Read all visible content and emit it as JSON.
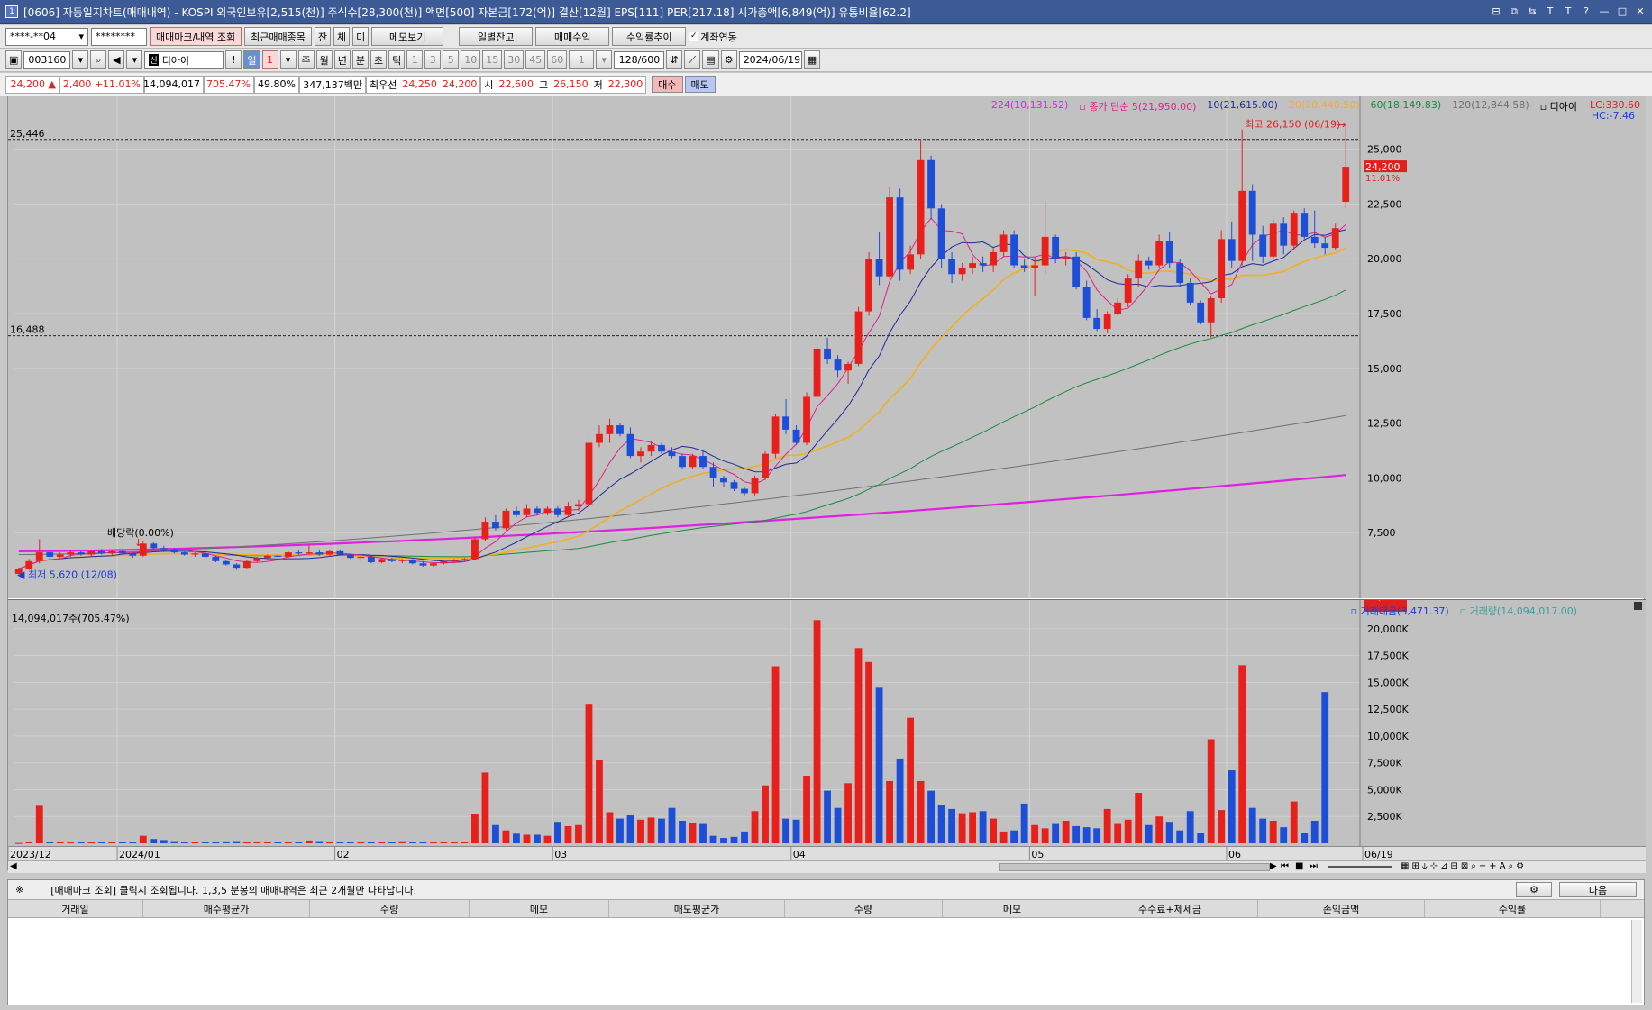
{
  "window": {
    "title": "[0606] 자동일지차트(매매내역) - KOSPI 외국인보유[2,515(천)] 주식수[28,300(천)] 액면[500] 자본금[172(억)] 결산[12월] EPS[111] PER[217.18] 시가총액[6,849(억)] 유통비율[62.2]",
    "window_number": "1"
  },
  "toolbar1": {
    "account": "****-**04",
    "password": "********",
    "btn_query": "매매마크/내역 조회",
    "btn_recent": "최근매매종목",
    "btn_jan": "잔",
    "btn_che": "체",
    "btn_mi": "미",
    "btn_memo": "메모보기",
    "btn_daily_balance": "일별잔고",
    "btn_trade_profit": "매매수익",
    "btn_yield_trend": "수익률추이",
    "chk_link_label": "계좌연동",
    "chk_link_checked": true
  },
  "toolbar2": {
    "code": "003160",
    "stock_name": "디아이",
    "market_badge": "신",
    "btn_excl": "!",
    "period_day": "일",
    "period_n": "1",
    "periods": [
      "주",
      "월",
      "년",
      "분",
      "초",
      "틱"
    ],
    "minutes": [
      "1",
      "3",
      "5",
      "10",
      "15",
      "30",
      "45",
      "60"
    ],
    "mult": "1",
    "count": "128/600",
    "date": "2024/06/19"
  },
  "quote": {
    "price": "24,200",
    "arrow": "▲",
    "change": "2,400",
    "change_pct": "+11.01%",
    "volume": "14,094,017",
    "vol_ratio": "705.47%",
    "turnover": "49.80%",
    "amount": "347,137백만",
    "best_label": "최우선",
    "best_ask": "24,250",
    "best_bid": "24,200",
    "open_label": "시",
    "open": "22,600",
    "high_label": "고",
    "high": "26,150",
    "low_label": "저",
    "low": "22,300",
    "buy_btn": "매수",
    "sell_btn": "매도"
  },
  "price_panel": {
    "legend": [
      {
        "text": "224(10,131.52)",
        "color": "#e020e0"
      },
      {
        "text": "종가 단순 5(21,950.00)",
        "color": "#e02090"
      },
      {
        "text": "10(21,615.00)",
        "color": "#1c2c9c"
      },
      {
        "text": "20(20,440.50)",
        "color": "#f0b020"
      },
      {
        "text": "60(18,149.83)",
        "color": "#1c8c3c"
      },
      {
        "text": "120(12,844.58)",
        "color": "#707070"
      },
      {
        "text": "디아이",
        "color": "#000000"
      }
    ],
    "lc_label": "LC:330.60",
    "hc_label": "HC:-7.46",
    "hline_high": "25,446",
    "hline_low": "16,488",
    "high_annot": "최고 26,150 (06/19)",
    "low_annot": "최저 5,620 (12/08)",
    "dividend_annot": "배당락(0.00%)",
    "current_price_tag": "24,200",
    "current_pct_tag": "11.01%",
    "yaxis": [
      "25,000",
      "22,500",
      "20,000",
      "17,500",
      "15,000",
      "12,500",
      "10,000",
      "7,500"
    ]
  },
  "volume_panel": {
    "header": "14,094,017주(705.47%)",
    "legend": [
      {
        "text": "거래대금(3,471.37)",
        "color": "#1c3cd8"
      },
      {
        "text": "거래량(14,094,017.00)",
        "color": "#3aa0a0"
      }
    ],
    "current_tag": "14,094K",
    "current_pct": "705.47%",
    "yaxis": [
      "20,000K",
      "17,500K",
      "15,000K",
      "12,500K",
      "10,000K",
      "7,500K",
      "5,000K",
      "2,500K"
    ]
  },
  "xaxis": [
    "2023/12",
    "2024/01",
    "02",
    "03",
    "04",
    "05",
    "06",
    "06/19"
  ],
  "bottom": {
    "notice_mark": "※",
    "notice": "[매매마크 조회] 클릭시 조회됩니다. 1,3,5 분봉의 매매내역은 최근 2개월만 나타납니다.",
    "next_btn": "다음",
    "columns": [
      "거래일",
      "매수평균가",
      "수량",
      "메모",
      "매도평균가",
      "수량",
      "메모",
      "수수료+제세금",
      "손익금액",
      "수익률"
    ]
  },
  "chart_data": {
    "type": "candlestick",
    "title": "디아이",
    "ylim": [
      5000,
      27000
    ],
    "vol_ylim": [
      0,
      21500
    ],
    "candles": [
      [
        5620,
        5900,
        5600,
        5850
      ],
      [
        5850,
        6300,
        5800,
        6200
      ],
      [
        6200,
        7200,
        6100,
        6600
      ],
      [
        6600,
        6700,
        6300,
        6400
      ],
      [
        6400,
        6600,
        6300,
        6500
      ],
      [
        6500,
        6700,
        6400,
        6600
      ],
      [
        6600,
        6650,
        6450,
        6500
      ],
      [
        6500,
        6700,
        6400,
        6650
      ],
      [
        6650,
        6750,
        6500,
        6550
      ],
      [
        6550,
        6700,
        6450,
        6650
      ],
      [
        6650,
        6700,
        6500,
        6550
      ],
      [
        6550,
        6600,
        6350,
        6450
      ],
      [
        6450,
        7100,
        6400,
        7000
      ],
      [
        7000,
        7050,
        6700,
        6800
      ],
      [
        6800,
        6900,
        6600,
        6750
      ],
      [
        6750,
        6800,
        6550,
        6600
      ],
      [
        6600,
        6650,
        6450,
        6500
      ],
      [
        6500,
        6600,
        6400,
        6550
      ],
      [
        6550,
        6600,
        6350,
        6400
      ],
      [
        6400,
        6450,
        6150,
        6200
      ],
      [
        6200,
        6250,
        6000,
        6050
      ],
      [
        6050,
        6100,
        5800,
        5900
      ],
      [
        5900,
        6250,
        5850,
        6200
      ],
      [
        6200,
        6400,
        6150,
        6350
      ],
      [
        6350,
        6500,
        6250,
        6450
      ],
      [
        6450,
        6550,
        6350,
        6400
      ],
      [
        6400,
        6650,
        6350,
        6600
      ],
      [
        6600,
        6700,
        6500,
        6550
      ],
      [
        6550,
        6950,
        6500,
        6600
      ],
      [
        6600,
        6700,
        6450,
        6500
      ],
      [
        6500,
        6700,
        6400,
        6650
      ],
      [
        6650,
        6700,
        6450,
        6500
      ],
      [
        6500,
        6550,
        6300,
        6350
      ],
      [
        6350,
        6450,
        6200,
        6400
      ],
      [
        6400,
        6450,
        6100,
        6150
      ],
      [
        6150,
        6350,
        6100,
        6300
      ],
      [
        6300,
        6350,
        6150,
        6200
      ],
      [
        6200,
        6300,
        6100,
        6250
      ],
      [
        6250,
        6300,
        6050,
        6100
      ],
      [
        6100,
        6200,
        5950,
        6000
      ],
      [
        6000,
        6150,
        5950,
        6100
      ],
      [
        6100,
        6250,
        6050,
        6200
      ],
      [
        6200,
        6300,
        6150,
        6250
      ],
      [
        6250,
        6350,
        6200,
        6300
      ],
      [
        6300,
        7300,
        6250,
        7200
      ],
      [
        7200,
        8200,
        7100,
        8000
      ],
      [
        8000,
        8300,
        7600,
        7700
      ],
      [
        7700,
        8600,
        7600,
        8500
      ],
      [
        8500,
        8700,
        8200,
        8300
      ],
      [
        8300,
        8800,
        8200,
        8600
      ],
      [
        8600,
        8700,
        8300,
        8400
      ],
      [
        8400,
        8700,
        8300,
        8600
      ],
      [
        8600,
        8700,
        8200,
        8300
      ],
      [
        8300,
        8900,
        8200,
        8700
      ],
      [
        8700,
        9000,
        8500,
        8800
      ],
      [
        8800,
        11900,
        8700,
        11600
      ],
      [
        11600,
        12400,
        11400,
        12000
      ],
      [
        12000,
        12700,
        11600,
        12400
      ],
      [
        12400,
        12500,
        11900,
        12000
      ],
      [
        12000,
        12300,
        10900,
        11000
      ],
      [
        11000,
        11400,
        10700,
        11200
      ],
      [
        11200,
        11700,
        11000,
        11500
      ],
      [
        11500,
        11600,
        11100,
        11200
      ],
      [
        11200,
        11400,
        10900,
        11000
      ],
      [
        11000,
        11100,
        10400,
        10500
      ],
      [
        10500,
        11100,
        10400,
        11000
      ],
      [
        11000,
        11200,
        10400,
        10500
      ],
      [
        10500,
        10700,
        9600,
        10000
      ],
      [
        10000,
        10100,
        9600,
        9800
      ],
      [
        9800,
        9900,
        9400,
        9500
      ],
      [
        9500,
        9600,
        9200,
        9300
      ],
      [
        9300,
        10100,
        9200,
        10000
      ],
      [
        10000,
        11200,
        9900,
        11100
      ],
      [
        11100,
        12900,
        10900,
        12800
      ],
      [
        12800,
        13600,
        12000,
        12200
      ],
      [
        12200,
        12400,
        11500,
        11600
      ],
      [
        11600,
        13900,
        11500,
        13700
      ],
      [
        13700,
        16400,
        13600,
        15900
      ],
      [
        15900,
        16400,
        15200,
        15400
      ],
      [
        15400,
        15600,
        14600,
        14900
      ],
      [
        14900,
        15300,
        14300,
        15200
      ],
      [
        15200,
        17800,
        15100,
        17600
      ],
      [
        17600,
        20300,
        17400,
        20000
      ],
      [
        20000,
        21200,
        18800,
        19200
      ],
      [
        19200,
        23300,
        19100,
        22800
      ],
      [
        22800,
        23200,
        19000,
        19500
      ],
      [
        19500,
        20600,
        19300,
        20200
      ],
      [
        20200,
        25450,
        20000,
        24500
      ],
      [
        24500,
        24700,
        21800,
        22300
      ],
      [
        22300,
        22500,
        19600,
        20000
      ],
      [
        20000,
        20300,
        18900,
        19300
      ],
      [
        19300,
        19800,
        19000,
        19600
      ],
      [
        19600,
        20100,
        19300,
        19800
      ],
      [
        19800,
        20100,
        19400,
        19700
      ],
      [
        19700,
        20500,
        19400,
        20300
      ],
      [
        20300,
        21300,
        20100,
        21100
      ],
      [
        21100,
        21300,
        19600,
        19700
      ],
      [
        19700,
        20000,
        19400,
        19600
      ],
      [
        19600,
        20100,
        18300,
        19700
      ],
      [
        19700,
        22600,
        19300,
        21000
      ],
      [
        21000,
        21100,
        19800,
        20000
      ],
      [
        20000,
        20300,
        19700,
        20100
      ],
      [
        20100,
        20300,
        18600,
        18700
      ],
      [
        18700,
        19000,
        17200,
        17300
      ],
      [
        17300,
        17700,
        16700,
        16800
      ],
      [
        16800,
        17600,
        16600,
        17500
      ],
      [
        17500,
        18200,
        17400,
        18000
      ],
      [
        18000,
        19300,
        17800,
        19100
      ],
      [
        19100,
        20200,
        18700,
        19900
      ],
      [
        19900,
        20100,
        19500,
        19700
      ],
      [
        19700,
        21100,
        19600,
        20800
      ],
      [
        20800,
        21200,
        19600,
        19800
      ],
      [
        19800,
        20000,
        18700,
        18900
      ],
      [
        18900,
        19100,
        17900,
        18000
      ],
      [
        18000,
        18100,
        17000,
        17100
      ],
      [
        17100,
        18300,
        16400,
        18200
      ],
      [
        18200,
        21300,
        18000,
        20900
      ],
      [
        20900,
        21700,
        19600,
        19900
      ],
      [
        19900,
        25900,
        19700,
        23100
      ],
      [
        23100,
        23400,
        19900,
        21100
      ],
      [
        21100,
        21500,
        19800,
        20100
      ],
      [
        20100,
        21800,
        20000,
        21600
      ],
      [
        21600,
        21900,
        20200,
        20600
      ],
      [
        20600,
        22200,
        20400,
        22100
      ],
      [
        22100,
        22300,
        20900,
        21000
      ],
      [
        21000,
        22200,
        20500,
        20700
      ],
      [
        20700,
        21000,
        20200,
        20500
      ],
      [
        20500,
        21600,
        20400,
        21400
      ],
      [
        22600,
        26150,
        22300,
        24200
      ]
    ],
    "volumes": [
      30,
      130,
      3500,
      100,
      120,
      90,
      100,
      80,
      100,
      90,
      130,
      80,
      700,
      400,
      300,
      200,
      150,
      120,
      130,
      150,
      180,
      200,
      100,
      120,
      110,
      100,
      130,
      110,
      260,
      200,
      150,
      110,
      120,
      130,
      140,
      100,
      160,
      190,
      130,
      140,
      110,
      100,
      100,
      100,
      2700,
      6600,
      1700,
      1200,
      900,
      800,
      800,
      700,
      2000,
      1600,
      1700,
      13000,
      7800,
      2900,
      2300,
      2600,
      2200,
      2400,
      2300,
      3300,
      2100,
      1900,
      1800,
      700,
      500,
      600,
      1100,
      3000,
      5400,
      16500,
      2300,
      2200,
      6300,
      20800,
      4900,
      3300,
      5600,
      18200,
      16900,
      14500,
      5800,
      7900,
      11700,
      5800,
      4900,
      3600,
      3200,
      2800,
      2900,
      3000,
      2300,
      1100,
      1200,
      3700,
      1700,
      1400,
      1800,
      2100,
      1600,
      1500,
      1400,
      3200,
      1800,
      2200,
      4700,
      1700,
      2500,
      2000,
      1200,
      3000,
      1000,
      9700,
      3100,
      6800,
      16600,
      3300,
      2300,
      2100,
      1500,
      3900,
      1000,
      2100,
      14094
    ],
    "vol_colors": "red=up, blue=down",
    "xlabel": "",
    "ylabel": ""
  }
}
